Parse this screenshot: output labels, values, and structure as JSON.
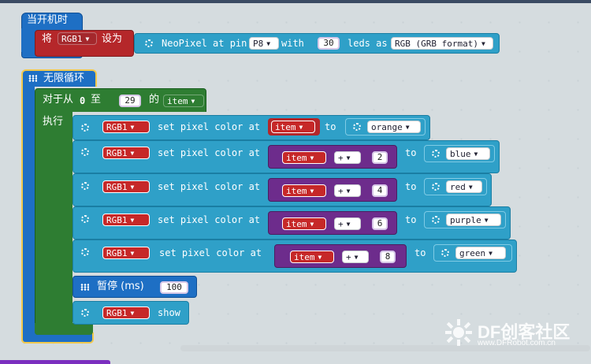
{
  "on_start": {
    "label": "当开机时",
    "set_label": "将",
    "var_name": "RGB1",
    "assign_label": "设为",
    "neopixel_label": "NeoPixel at pin",
    "pin": "P8",
    "with_label": "with",
    "led_count": "30",
    "leds_as_label": "leds as",
    "format": "RGB (GRB format)"
  },
  "forever": {
    "label": "无限循环",
    "loop": {
      "for_label": "对于从",
      "from_value": "0",
      "to_label": "至",
      "to_value": "29",
      "of_label": "的",
      "index_var": "item",
      "do_label": "执行"
    },
    "set_rows": [
      {
        "strip": "RGB1",
        "action": "set pixel color at",
        "index_var": "item",
        "op": "",
        "offset": "",
        "to_label": "to",
        "color": "orange"
      },
      {
        "strip": "RGB1",
        "action": "set pixel color at",
        "index_var": "item",
        "op": "+",
        "offset": "2",
        "to_label": "to",
        "color": "blue"
      },
      {
        "strip": "RGB1",
        "action": "set pixel color at",
        "index_var": "item",
        "op": "+",
        "offset": "4",
        "to_label": "to",
        "color": "red"
      },
      {
        "strip": "RGB1",
        "action": "set pixel color at",
        "index_var": "item",
        "op": "+",
        "offset": "6",
        "to_label": "to",
        "color": "purple"
      },
      {
        "strip": "RGB1",
        "action": "set pixel color at",
        "index_var": "item",
        "op": "+",
        "offset": "8",
        "to_label": "to",
        "color": "green"
      }
    ],
    "pause": {
      "label": "暂停 (ms)",
      "value": "100"
    },
    "show": {
      "strip": "RGB1",
      "label": "show"
    }
  },
  "watermark": {
    "brand": "DF创客社区",
    "url": "www.DFRobot.com.cn"
  },
  "colors": {
    "start_blue": "#1e6fc4",
    "on_start_red": "#b5272a",
    "neopixel_cyan": "#2fa0c8",
    "loop_green": "#2e7d32",
    "math_purple": "#6d2c8c",
    "forever_border": "#f2c94c",
    "canvas": "#ecf0f1"
  }
}
